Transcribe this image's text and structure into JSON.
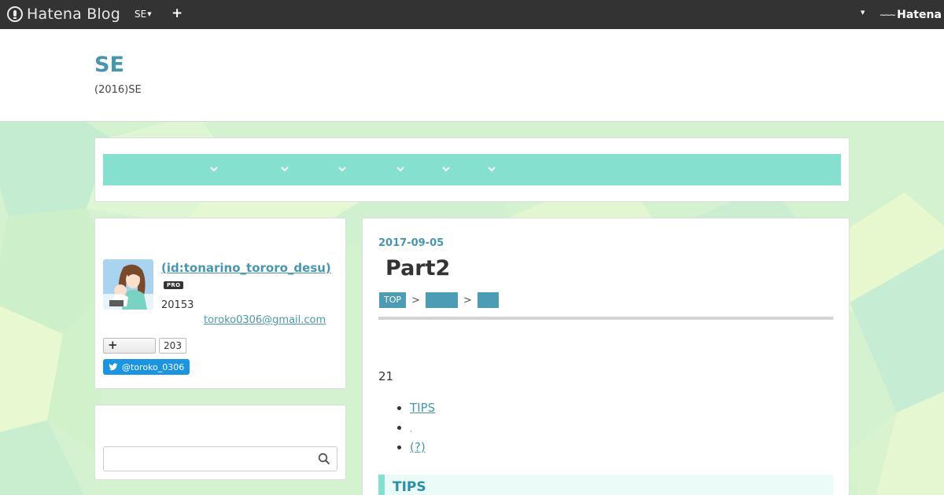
{
  "globalbar": {
    "logo_text": "Hatena Blog",
    "blog_switch_label": "SE",
    "plus_label": "+",
    "hatena_label": "Hatena"
  },
  "header": {
    "title": "SE",
    "description": "(2016)SE"
  },
  "nav": {
    "accent_color": "#86e0cf",
    "item_count": 6
  },
  "profile": {
    "name": " (id:tonarino_tororo_desu)",
    "badge": "PRO",
    "count_text": "20153",
    "email": "toroko0306@gmail.com",
    "follow_label": "+",
    "follow_count": "203",
    "twitter_label": "@toroko_0306"
  },
  "search": {
    "placeholder": ""
  },
  "entry": {
    "date": "2017-09-05",
    "title": "Part2",
    "breadcrumbs": [
      "TOP",
      "",
      ""
    ],
    "crumb_separator": ">",
    "intro": "21",
    "list": [
      "TIPS",
      ",",
      "(?)"
    ],
    "section_heading": "TIPS"
  },
  "colors": {
    "link": "#4796ae",
    "globalbar": "#333333",
    "twitter": "#1b95e0"
  }
}
